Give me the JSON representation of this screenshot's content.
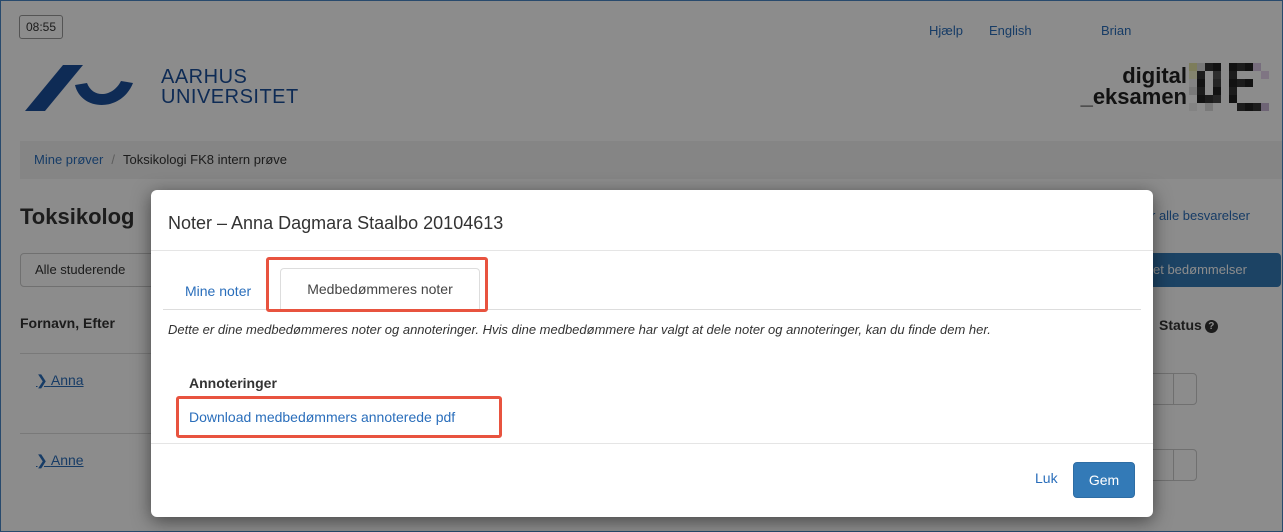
{
  "header": {
    "clock": "08:55",
    "links": {
      "help": "Hjælp",
      "language": "English",
      "user": "Brian"
    },
    "university": {
      "line1": "AARHUS",
      "line2": "UNIVERSITET"
    },
    "brand": {
      "line1": "digital",
      "line2": "_eksamen"
    }
  },
  "breadcrumb": {
    "home": "Mine prøver",
    "separator": "/",
    "current": "Toksikologi FK8 intern prøve"
  },
  "background": {
    "page_title": "Toksikolog",
    "filter_select": "Alle studerende",
    "column_name": "Fornavn, Efter",
    "column_status": "Status",
    "rows": [
      {
        "name": "Anna"
      },
      {
        "name": "Anne"
      }
    ],
    "right_link": "r alle besvarelser",
    "right_button": "et bedømmelser"
  },
  "modal": {
    "title": "Noter  –  Anna Dagmara Staalbo 20104613",
    "tabs": [
      {
        "label": "Mine noter",
        "active": false
      },
      {
        "label": "Medbedømmeres noter",
        "active": true
      }
    ],
    "description": "Dette er dine medbedømmeres noter og annoteringer. Hvis dine medbedømmere har valgt at dele noter og annoteringer, kan du finde dem her.",
    "annotations_heading": "Annoteringer",
    "download_link": "Download medbedømmers annoterede pdf",
    "close_label": "Luk",
    "save_label": "Gem"
  },
  "colors": {
    "link": "#2a6ebb",
    "primary": "#337ab7",
    "highlight": "#e8533f",
    "au_blue": "#1b4f9c"
  }
}
